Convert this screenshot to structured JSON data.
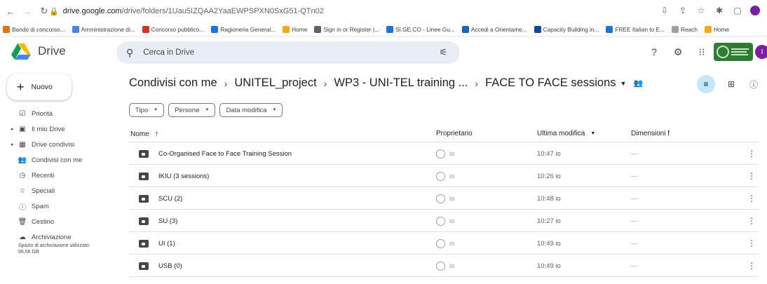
{
  "browser": {
    "url_host": "drive.google.com",
    "url_path": "/drive/folders/1Uau5IZQAA2YaaEWPSPXN0SxG51-QTn02"
  },
  "bookmarks": [
    {
      "label": "Bando di concorso...",
      "color": "#e8710a"
    },
    {
      "label": "Amministrazione di...",
      "color": "#4285f4"
    },
    {
      "label": "Concorso pubblico...",
      "color": "#d93025"
    },
    {
      "label": "Ragioneria General...",
      "color": "#1a73e8"
    },
    {
      "label": "Home",
      "color": "#f9ab00"
    },
    {
      "label": "Sign in or Register |...",
      "color": "#5f6368"
    },
    {
      "label": "SI.GE.CO - Linee Gu...",
      "color": "#1a73e8"
    },
    {
      "label": "Accedi a Orientame...",
      "color": "#1565c0"
    },
    {
      "label": "Capacity Building in...",
      "color": "#0d47a1"
    },
    {
      "label": "FREE Italian to E...",
      "color": "#1976d2"
    },
    {
      "label": "Reach",
      "color": "#9aa0a6"
    },
    {
      "label": "Home",
      "color": "#f9ab00"
    }
  ],
  "header": {
    "app_name": "Drive",
    "search_placeholder": "Cerca in Drive",
    "avatar_letter": "I"
  },
  "sidebar": {
    "new_label": "Nuovo",
    "items": [
      {
        "label": "Priorità",
        "icon": "priority-icon",
        "glyph": "☑",
        "caret": false
      },
      {
        "label": "Il mio Drive",
        "icon": "my-drive-icon",
        "glyph": "▣",
        "caret": true
      },
      {
        "label": "Drive condivisi",
        "icon": "shared-drives-icon",
        "glyph": "▦",
        "caret": true
      },
      {
        "label": "Condivisi con me",
        "icon": "shared-with-me-icon",
        "glyph": "👥",
        "caret": false
      },
      {
        "label": "Recenti",
        "icon": "recent-icon",
        "glyph": "◷",
        "caret": false
      },
      {
        "label": "Speciali",
        "icon": "starred-icon",
        "glyph": "☆",
        "caret": false
      },
      {
        "label": "Spam",
        "icon": "spam-icon",
        "glyph": "ⓘ",
        "caret": false
      },
      {
        "label": "Cestino",
        "icon": "trash-icon",
        "glyph": "🗑",
        "caret": false
      },
      {
        "label": "Archiviazione",
        "icon": "storage-icon",
        "glyph": "☁",
        "caret": false
      }
    ],
    "storage_text": "Spazio di archiviazione utilizzato: 96,56 GB"
  },
  "breadcrumb": {
    "items": [
      "Condivisi con me",
      "UNITEL_project",
      "WP3 - UNI-TEL training ...",
      "FACE TO FACE sessions"
    ]
  },
  "filters": [
    "Tipo",
    "Persone",
    "Data modifica"
  ],
  "table": {
    "headers": {
      "name": "Nome",
      "owner": "Proprietario",
      "modified": "Ultima modifica",
      "size": "Dimensioni f"
    },
    "rows": [
      {
        "name": "Co-Organised Face to Face Training Session",
        "owner": "io",
        "modified": "10:47 io",
        "size": "—"
      },
      {
        "name": "IKIU (3 sessions)",
        "owner": "io",
        "modified": "10:26 io",
        "size": "—"
      },
      {
        "name": "SCU (2)",
        "owner": "io",
        "modified": "10:48 io",
        "size": "—"
      },
      {
        "name": "SU (3)",
        "owner": "io",
        "modified": "10:27 io",
        "size": "—"
      },
      {
        "name": "UI (1)",
        "owner": "io",
        "modified": "10:49 io",
        "size": "—"
      },
      {
        "name": "USB (0)",
        "owner": "io",
        "modified": "10:49 io",
        "size": "—"
      }
    ]
  }
}
